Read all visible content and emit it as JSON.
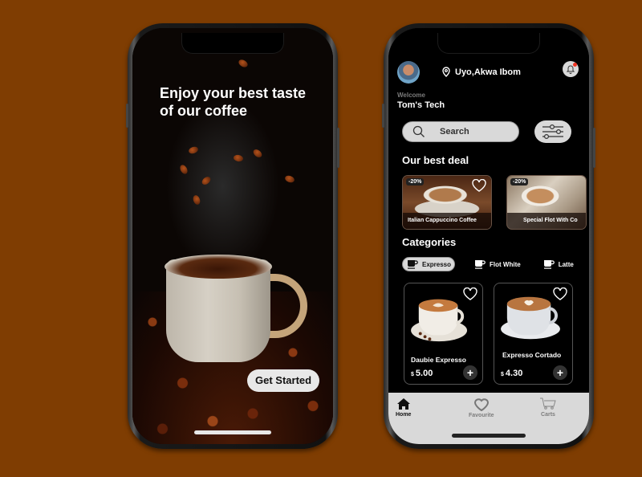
{
  "splash": {
    "title": "Enjoy your best taste of our coffee",
    "cta_label": "Get Started"
  },
  "home": {
    "location": "Uyo,Akwa Ibom",
    "welcome": "Welcome",
    "user_name": "Tom's Tech",
    "search_placeholder": "Search",
    "best_deal_title": "Our best deal",
    "deals": [
      {
        "badge": "-20%",
        "title": "Italian Cappuccino Coffee"
      },
      {
        "badge": "-20%",
        "title": "Special Flot With Co"
      }
    ],
    "categories_title": "Categories",
    "categories": [
      {
        "label": "Expresso",
        "active": true
      },
      {
        "label": "Flot White",
        "active": false
      },
      {
        "label": "Latte",
        "active": false
      }
    ],
    "products": [
      {
        "name": "Daubie Expresso",
        "currency": "$",
        "price": "5.00"
      },
      {
        "name": "Expresso Cortado",
        "currency": "$",
        "price": "4.30"
      }
    ],
    "nav": [
      {
        "label": "Home",
        "icon": "home-icon",
        "active": true
      },
      {
        "label": "Favourite",
        "icon": "heart-icon",
        "active": false
      },
      {
        "label": "Carts",
        "icon": "cart-icon",
        "active": false
      }
    ]
  },
  "colors": {
    "background": "#7f3d02",
    "surface_light": "#d9d9d9",
    "notification_dot": "#ee3322"
  }
}
